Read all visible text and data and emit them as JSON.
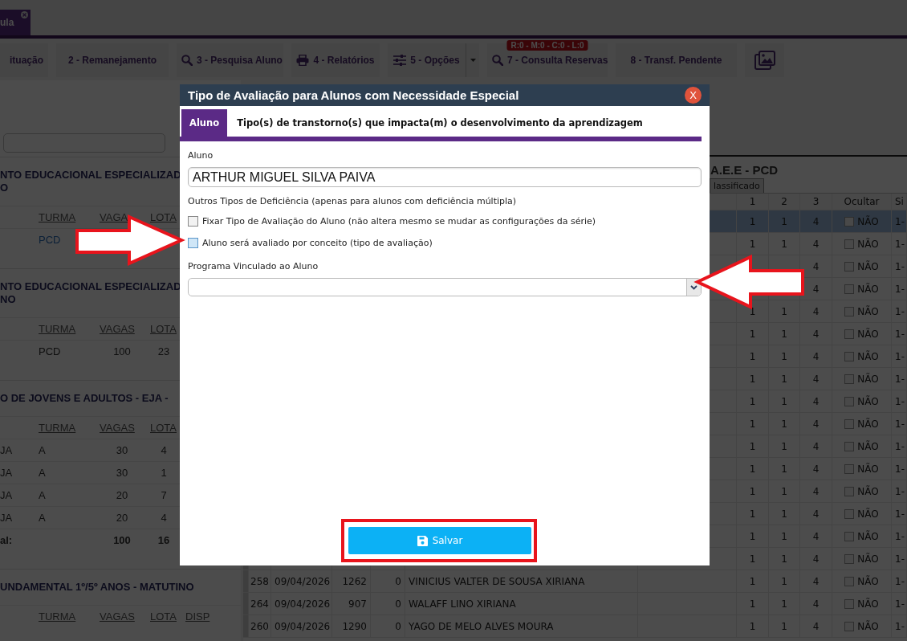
{
  "page_tab": {
    "label": "ula"
  },
  "toolbar": [
    {
      "kind": "text",
      "label": "ituação"
    },
    {
      "kind": "text",
      "label": "2 - Remanejamento"
    },
    {
      "kind": "search",
      "label": "3 - Pesquisa Aluno"
    },
    {
      "kind": "print",
      "label": "4 - Relatórios"
    },
    {
      "kind": "sliders",
      "label": "5 - Opções",
      "dropdown": true
    },
    {
      "kind": "search",
      "label": "7 - Consulta Reservas",
      "badge": "R:0 - M:0 - C:0 - L:0"
    },
    {
      "kind": "text",
      "label": "8 - Transf. Pendente"
    },
    {
      "kind": "images"
    }
  ],
  "school_list": {
    "sections": [
      {
        "title_lines": [
          "NTO EDUCACIONAL ESPECIALIZAD",
          "O"
        ],
        "columns": [
          "TURMA",
          "VAGA",
          "LOTA"
        ],
        "rows": [
          {
            "kind": "link",
            "turma": "PCD"
          }
        ]
      },
      {
        "title_lines": [
          "NTO EDUCACIONAL ESPECIALIZAD",
          "NO"
        ],
        "columns": [
          "TURMA",
          "VAGAS",
          "LOTA"
        ],
        "rows": [
          {
            "kind": "plain",
            "turma": "PCD",
            "vagas": "100",
            "lota": "23"
          }
        ]
      },
      {
        "title_lines": [
          "O DE JOVENS E ADULTOS - EJA -"
        ],
        "columns": [
          "TURMA",
          "VAGAS",
          "LOTA"
        ],
        "rows": [
          {
            "kind": "plain",
            "column_1": "JA",
            "turma": "A",
            "vagas": "30",
            "lota": "4"
          },
          {
            "kind": "plain",
            "column_1": "JA",
            "turma": "A",
            "vagas": "30",
            "lota": "1"
          },
          {
            "kind": "plain",
            "column_1": "JA",
            "turma": "A",
            "vagas": "20",
            "lota": "7"
          },
          {
            "kind": "plain",
            "column_1": "JA",
            "turma": "A",
            "vagas": "20",
            "lota": "4"
          },
          {
            "kind": "total",
            "column_1": "al:",
            "vagas": "100",
            "lota": "16"
          }
        ]
      },
      {
        "title_lines": [
          "UNDAMENTAL 1º/5º ANOS - MATUTINO"
        ],
        "columns": [
          "TURMA",
          "VAGAS",
          "LOTA",
          "DISP"
        ]
      }
    ]
  },
  "grid": {
    "title": "A.E.E - PCD",
    "filter_button": "lassificado",
    "columns": [
      "1",
      "2",
      "3",
      "Ocultar",
      "Si"
    ],
    "rows": [
      {
        "selected": true,
        "c1": "1",
        "c2": "1",
        "c3": "4",
        "ocultar": {
          "label": "NÃO",
          "checked": false
        },
        "si": "1-"
      },
      {
        "selected": false,
        "c1": "1",
        "c2": "1",
        "c3": "4",
        "ocultar": {
          "label": "NÃO",
          "checked": false
        },
        "si": "1-"
      },
      {
        "selected": false,
        "c3": "4",
        "ocultar": {
          "label": "NÃO",
          "checked": false
        },
        "si": "1-"
      },
      {
        "selected": false,
        "c3": "4",
        "ocultar": {
          "label": "NÃO",
          "checked": false
        },
        "si": "1-"
      },
      {
        "selected": false,
        "c1": "1",
        "c2": "1",
        "c3": "4",
        "ocultar": {
          "label": "NÃO",
          "checked": false
        },
        "si": "1-"
      },
      {
        "selected": false,
        "c1": "1",
        "c2": "1",
        "c3": "4",
        "ocultar": {
          "label": "NÃO",
          "checked": false
        },
        "si": "1-"
      },
      {
        "selected": false,
        "c1": "1",
        "c2": "1",
        "c3": "4",
        "ocultar": {
          "label": "NÃO",
          "checked": false
        },
        "si": "1-"
      },
      {
        "selected": false,
        "c1": "1",
        "c2": "1",
        "c3": "4",
        "ocultar": {
          "label": "NÃO",
          "checked": false
        },
        "si": "1-"
      },
      {
        "selected": false,
        "c1": "1",
        "c2": "1",
        "c3": "4",
        "ocultar": {
          "label": "NÃO",
          "checked": false
        },
        "si": "1-"
      },
      {
        "selected": false,
        "c1": "1",
        "c2": "1",
        "c3": "4",
        "ocultar": {
          "label": "NÃO",
          "checked": false
        },
        "si": "1-"
      },
      {
        "selected": false,
        "c1": "1",
        "c2": "1",
        "c3": "4",
        "ocultar": {
          "label": "NÃO",
          "checked": false
        },
        "si": "1-"
      },
      {
        "selected": false,
        "c1": "1",
        "c2": "1",
        "c3": "4",
        "ocultar": {
          "label": "NÃO",
          "checked": false
        },
        "si": "1-"
      },
      {
        "selected": false,
        "c1": "1",
        "c2": "1",
        "c3": "4",
        "ocultar": {
          "label": "NÃO",
          "checked": false
        },
        "si": "1-"
      },
      {
        "selected": false,
        "c1": "1",
        "c2": "1",
        "c3": "4",
        "ocultar": {
          "label": "NÃO",
          "checked": false
        },
        "si": "1-"
      },
      {
        "selected": false,
        "c1": "1",
        "c2": "1",
        "c3": "4",
        "ocultar": {
          "label": "NÃO",
          "checked": false
        },
        "si": "1-"
      },
      {
        "selected": false,
        "c1": "1",
        "c2": "1",
        "c3": "4",
        "ocultar": {
          "label": "NÃO",
          "checked": false
        },
        "si": "1-"
      },
      {
        "selected": false,
        "column_1": "258",
        "column_2": "09/04/2026",
        "column_3": "1262",
        "column_4": "0",
        "column_5": "VINICIUS VALTER DE SOUSA XIRIANA",
        "c1": "1",
        "c2": "1",
        "c3": "4",
        "ocultar": {
          "label": "NÃO",
          "checked": false
        },
        "si": "1-"
      },
      {
        "selected": false,
        "column_1": "264",
        "column_2": "09/04/2026",
        "column_3": "907",
        "column_4": "0",
        "column_5": "WALAFF LINO XIRIANA",
        "c1": "1",
        "c2": "1",
        "c3": "4",
        "ocultar": {
          "label": "NÃO",
          "checked": false
        },
        "si": "1-"
      },
      {
        "selected": false,
        "column_1": "260",
        "column_2": "09/04/2026",
        "column_3": "1290",
        "column_4": "0",
        "column_5": "YAGO DE MELO ALVES MOURA",
        "c1": "1",
        "c2": "1",
        "c3": "4",
        "ocultar": {
          "label": "NÃO",
          "checked": false
        },
        "si": "1-"
      }
    ]
  },
  "modal": {
    "title": "Tipo de Avaliação para Alunos com Necessidade Especial",
    "close": "X",
    "tabs": [
      {
        "label": "Aluno",
        "selected": true
      },
      {
        "label": "Tipo(s) de transtorno(s) que impacta(m) o desenvolvimento da aprendizagem",
        "selected": false
      }
    ],
    "student_label": "Aluno",
    "student_value": "ARTHUR MIGUEL SILVA PAIVA",
    "note": "Outros Tipos de Deficiência (apenas para alunos com deficiência múltipla)",
    "checkboxes": [
      {
        "label": "Fixar Tipo de Avaliação do Aluno (não altera mesmo se mudar as configurações da série)",
        "checked": false,
        "focused": false
      },
      {
        "label": "Aluno será avaliado por conceito (tipo de avaliação)",
        "checked": false,
        "focused": true
      }
    ],
    "program_label": "Programa Vinculado ao Aluno",
    "save_button": "Salvar"
  },
  "annotations": [
    {
      "kind": "arrow-right"
    },
    {
      "kind": "arrow-left"
    },
    {
      "kind": "frame"
    }
  ]
}
